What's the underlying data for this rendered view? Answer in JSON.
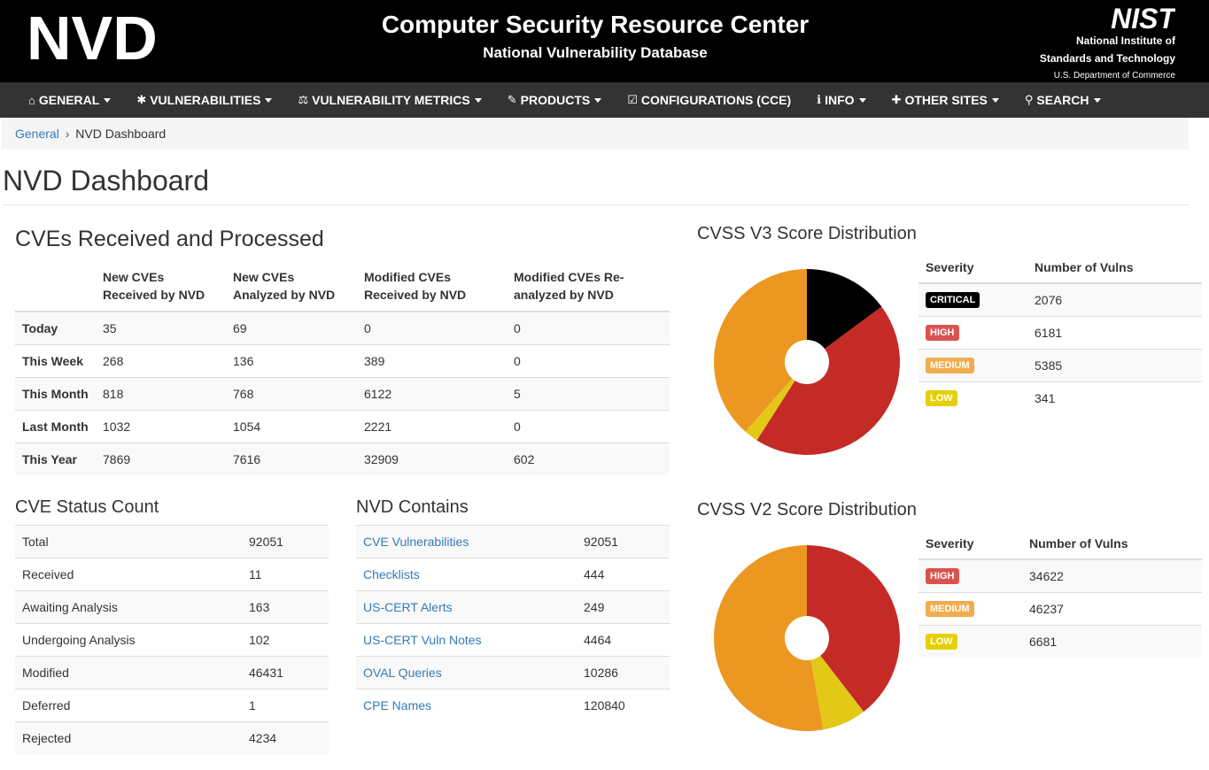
{
  "header": {
    "logo_text": "NVD",
    "title": "Computer Security Resource Center",
    "subtitle": "National Vulnerability Database",
    "nist_logo": "NIST",
    "nist_line1": "National Institute of",
    "nist_line2": "Standards and Technology",
    "nist_line3": "U.S. Department of Commerce"
  },
  "nav": [
    {
      "label": "GENERAL",
      "icon": "home-icon",
      "glyph": "⌂"
    },
    {
      "label": "VULNERABILITIES",
      "icon": "bug-icon",
      "glyph": "✱"
    },
    {
      "label": "VULNERABILITY METRICS",
      "icon": "balance-scale-icon",
      "glyph": "⚖"
    },
    {
      "label": "PRODUCTS",
      "icon": "wrench-icon",
      "glyph": "✎"
    },
    {
      "label": "CONFIGURATIONS (CCE)",
      "icon": "check-square-icon",
      "glyph": "☑"
    },
    {
      "label": "INFO",
      "icon": "info-circle-icon",
      "glyph": "ℹ"
    },
    {
      "label": "OTHER SITES",
      "icon": "plus-icon",
      "glyph": "✚"
    },
    {
      "label": "SEARCH",
      "icon": "search-icon",
      "glyph": "⚲"
    }
  ],
  "breadcrumb": {
    "link": "General",
    "sep": "›",
    "current": "NVD Dashboard"
  },
  "page_title": "NVD Dashboard",
  "cves": {
    "title": "CVEs Received and Processed",
    "headers": [
      "",
      "New CVEs Received by NVD",
      "New CVEs Analyzed by NVD",
      "Modified CVEs Received by NVD",
      "Modified CVEs Re-analyzed by NVD"
    ],
    "rows": [
      {
        "label": "Today",
        "values": [
          "35",
          "69",
          "0",
          "0"
        ]
      },
      {
        "label": "This Week",
        "values": [
          "268",
          "136",
          "389",
          "0"
        ]
      },
      {
        "label": "This Month",
        "values": [
          "818",
          "768",
          "6122",
          "5"
        ]
      },
      {
        "label": "Last Month",
        "values": [
          "1032",
          "1054",
          "2221",
          "0"
        ]
      },
      {
        "label": "This Year",
        "values": [
          "7869",
          "7616",
          "32909",
          "602"
        ]
      }
    ]
  },
  "status": {
    "title": "CVE Status Count",
    "rows": [
      {
        "label": "Total",
        "value": "92051"
      },
      {
        "label": "Received",
        "value": "11"
      },
      {
        "label": "Awaiting Analysis",
        "value": "163"
      },
      {
        "label": "Undergoing Analysis",
        "value": "102"
      },
      {
        "label": "Modified",
        "value": "46431"
      },
      {
        "label": "Deferred",
        "value": "1"
      },
      {
        "label": "Rejected",
        "value": "4234"
      }
    ]
  },
  "contains": {
    "title": "NVD Contains",
    "rows": [
      {
        "label": "CVE Vulnerabilities",
        "value": "92051"
      },
      {
        "label": "Checklists",
        "value": "444"
      },
      {
        "label": "US-CERT Alerts",
        "value": "249"
      },
      {
        "label": "US-CERT Vuln Notes",
        "value": "4464"
      },
      {
        "label": "OVAL Queries",
        "value": "10286"
      },
      {
        "label": "CPE Names",
        "value": "120840"
      }
    ]
  },
  "colors": {
    "critical": "#000000",
    "high": "#c42b27",
    "medium": "#ec9722",
    "low": "#e3c817"
  },
  "chart_data": [
    {
      "type": "pie",
      "title": "CVSS V3 Score Distribution",
      "col_severity": "Severity",
      "col_count": "Number of Vulns",
      "categories": [
        "CRITICAL",
        "HIGH",
        "MEDIUM",
        "LOW"
      ],
      "values": [
        2076,
        6181,
        5385,
        341
      ],
      "slice_order": [
        "CRITICAL",
        "HIGH",
        "LOW",
        "MEDIUM"
      ],
      "classes": [
        "critical",
        "high",
        "medium",
        "low"
      ]
    },
    {
      "type": "pie",
      "title": "CVSS V2 Score Distribution",
      "col_severity": "Severity",
      "col_count": "Number of Vulns",
      "categories": [
        "HIGH",
        "MEDIUM",
        "LOW"
      ],
      "values": [
        34622,
        46237,
        6681
      ],
      "slice_order": [
        "HIGH",
        "LOW",
        "MEDIUM"
      ],
      "classes": [
        "high",
        "medium",
        "low"
      ]
    }
  ]
}
